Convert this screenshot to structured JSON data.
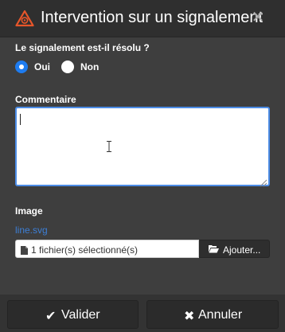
{
  "dialog": {
    "title": "Intervention sur un signalement",
    "icon": "warning-triangle-icon",
    "close_icon": "close-icon",
    "accent_color": "#e8562a"
  },
  "form": {
    "resolved_question": "Le signalement est-il résolu ?",
    "options": [
      {
        "label": "Oui",
        "checked": true
      },
      {
        "label": "Non",
        "checked": false
      }
    ],
    "comment_label": "Commentaire",
    "comment_value": "",
    "image_label": "Image",
    "file_name": "line.svg",
    "file_status": "1 fichier(s) sélectionné(s)",
    "add_button": "Ajouter..."
  },
  "footer": {
    "validate": "Valider",
    "cancel": "Annuler"
  },
  "colors": {
    "radio_checked": "#1e7cf0",
    "focus_border": "#4c8ce6",
    "link": "#3d7fd6"
  }
}
